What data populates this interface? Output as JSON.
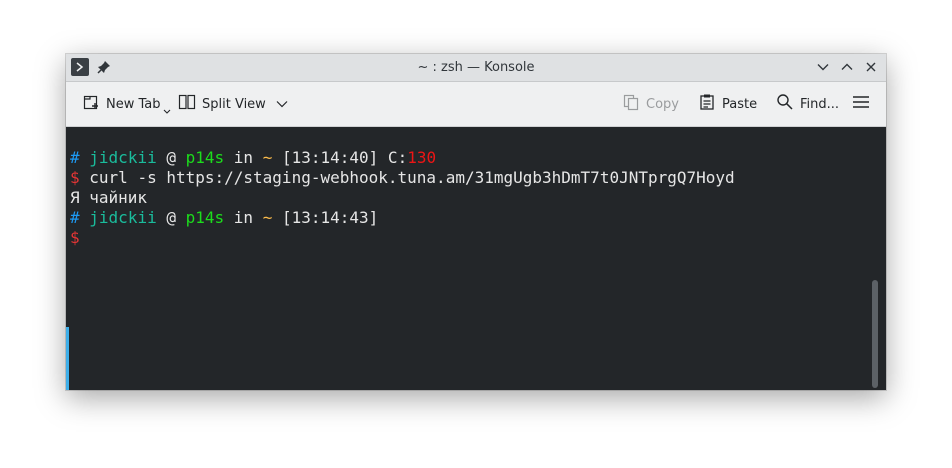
{
  "window": {
    "title": "~ : zsh — Konsole",
    "icons": [
      "terminal-app-icon",
      "pin-icon",
      "minimize-icon",
      "maximize-icon",
      "close-icon"
    ]
  },
  "toolbar": {
    "new_tab_label": "New Tab",
    "split_view_label": "Split View",
    "copy_label": "Copy",
    "paste_label": "Paste",
    "find_label": "Find..."
  },
  "terminal": {
    "line1": {
      "hash": "#",
      "user": "jidckii",
      "at": " @ ",
      "host": "p14s",
      "in": " in ",
      "dir": "~",
      "time": " [13:14:40]",
      "code_label": " C:",
      "code": "130"
    },
    "line2": {
      "dollar": "$",
      "command": " curl -s https://staging-webhook.tuna.am/31mgUgb3hDmT7t0JNTprgQ7Hoyd"
    },
    "line3": {
      "output": "Я чайник"
    },
    "line4": {
      "hash": "#",
      "user": "jidckii",
      "at": " @ ",
      "host": "p14s",
      "in": " in ",
      "dir": "~",
      "time": " [13:14:43]"
    },
    "line5": {
      "dollar": "$"
    }
  },
  "colors": {
    "background": "#232629",
    "hash": "#1d99f3",
    "user": "#1abc9c",
    "host": "#1cdc1c",
    "dir": "#fdbc4b",
    "error": "#ed1515",
    "prompt": "#e33535"
  }
}
